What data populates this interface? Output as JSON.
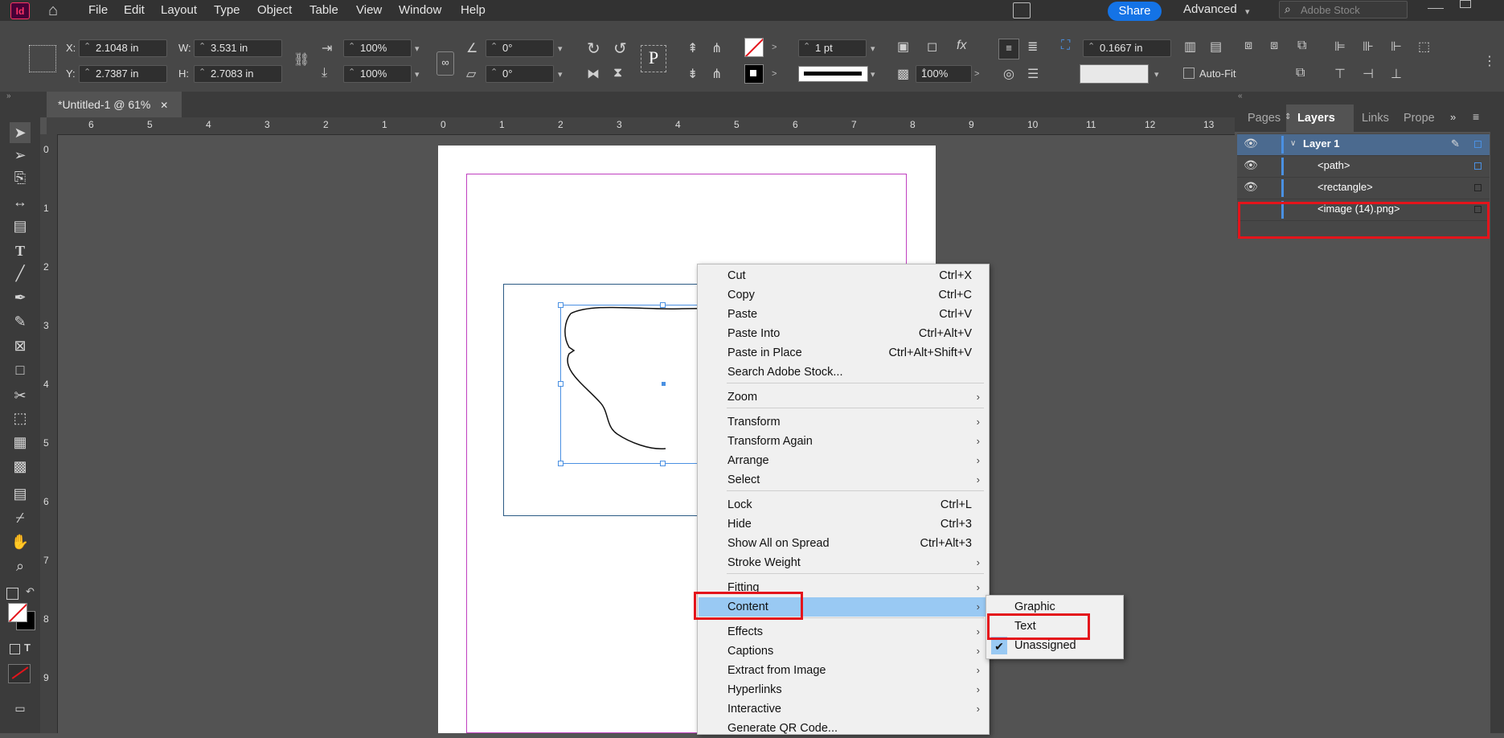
{
  "app": {
    "logo": "Id"
  },
  "menu": [
    "File",
    "Edit",
    "Layout",
    "Type",
    "Object",
    "Table",
    "View",
    "Window",
    "Help"
  ],
  "header": {
    "share": "Share",
    "workspace": "Advanced",
    "stock_placeholder": "Adobe Stock"
  },
  "control": {
    "x_label": "X:",
    "x_value": "2.1048 in",
    "y_label": "Y:",
    "y_value": "2.7387 in",
    "w_label": "W:",
    "w_value": "3.531 in",
    "h_label": "H:",
    "h_value": "2.7083 in",
    "scale_x": "100%",
    "scale_y": "100%",
    "rotate": "0°",
    "shear": "0°",
    "stroke_weight": "1 pt",
    "opacity": "100%",
    "inset": "0.1667 in",
    "autofit": "Auto-Fit"
  },
  "doc_tab": {
    "title": "*Untitled-1 @ 61%",
    "close": "✕"
  },
  "ruler": {
    "h": [
      "6",
      "5",
      "4",
      "3",
      "2",
      "1",
      "0",
      "1",
      "2",
      "3",
      "4",
      "5",
      "6",
      "7",
      "8",
      "9",
      "10",
      "11",
      "12",
      "13"
    ],
    "v": [
      "0",
      "1",
      "2",
      "3",
      "4",
      "5",
      "6",
      "7",
      "8",
      "9"
    ]
  },
  "context_menu": {
    "items": [
      {
        "label": "Cut",
        "shortcut": "Ctrl+X"
      },
      {
        "label": "Copy",
        "shortcut": "Ctrl+C"
      },
      {
        "label": "Paste",
        "shortcut": "Ctrl+V"
      },
      {
        "label": "Paste Into",
        "shortcut": "Ctrl+Alt+V"
      },
      {
        "label": "Paste in Place",
        "shortcut": "Ctrl+Alt+Shift+V"
      },
      {
        "label": "Search Adobe Stock...",
        "shortcut": ""
      },
      {
        "label": "Zoom",
        "submenu": true
      },
      {
        "label": "Transform",
        "submenu": true
      },
      {
        "label": "Transform Again",
        "submenu": true
      },
      {
        "label": "Arrange",
        "submenu": true
      },
      {
        "label": "Select",
        "submenu": true
      },
      {
        "label": "Lock",
        "shortcut": "Ctrl+L"
      },
      {
        "label": "Hide",
        "shortcut": "Ctrl+3"
      },
      {
        "label": "Show All on Spread",
        "shortcut": "Ctrl+Alt+3"
      },
      {
        "label": "Stroke Weight",
        "submenu": true
      },
      {
        "label": "Fitting",
        "submenu": true
      },
      {
        "label": "Content",
        "submenu": true,
        "highlighted": true
      },
      {
        "label": "Effects",
        "submenu": true
      },
      {
        "label": "Captions",
        "submenu": true
      },
      {
        "label": "Extract from Image",
        "submenu": true
      },
      {
        "label": "Hyperlinks",
        "submenu": true
      },
      {
        "label": "Interactive",
        "submenu": true
      },
      {
        "label": "Generate QR Code...",
        "shortcut": ""
      }
    ]
  },
  "submenu": {
    "items": [
      "Graphic",
      "Text",
      "Unassigned"
    ],
    "checked": "Unassigned"
  },
  "panel": {
    "tabs": [
      "Pages",
      "Layers",
      "Links",
      "Prope"
    ],
    "active_tab": "Layers",
    "layers": [
      {
        "name": "Layer 1",
        "visible": true
      },
      {
        "name": "<path>",
        "visible": true
      },
      {
        "name": "<rectangle>",
        "visible": true
      },
      {
        "name": "<image (14).png>",
        "visible": false
      }
    ]
  },
  "colors": {
    "accent": "#1473e6",
    "highlight": "#99c9f3",
    "annotation_red": "#e4141b",
    "margin_guide": "#c040c0"
  }
}
